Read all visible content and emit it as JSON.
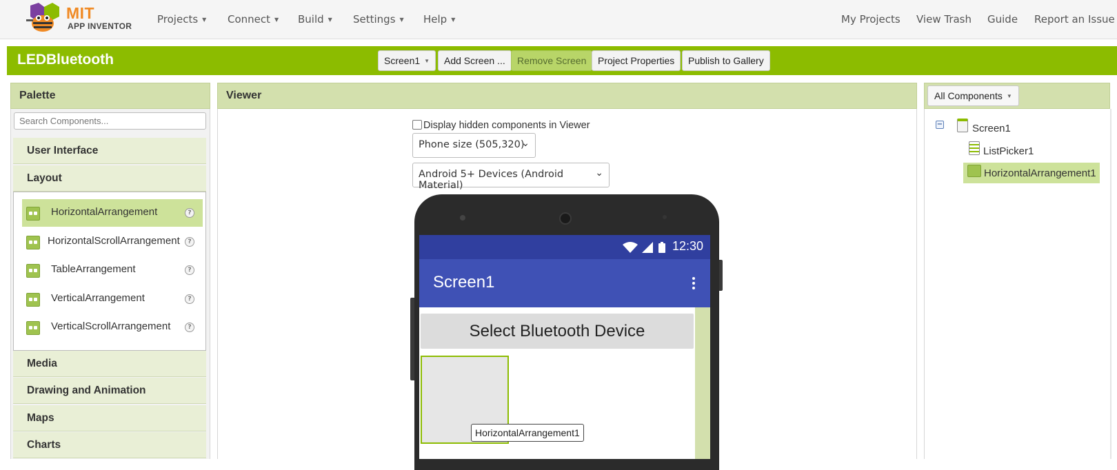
{
  "brand": {
    "line1": "MIT",
    "line2": "APP INVENTOR"
  },
  "nav": {
    "left": [
      "Projects",
      "Connect",
      "Build",
      "Settings",
      "Help"
    ],
    "right": [
      "My Projects",
      "View Trash",
      "Guide",
      "Report an Issue"
    ]
  },
  "project": {
    "name": "LEDBluetooth",
    "screen_select": "Screen1",
    "add_screen": "Add Screen ...",
    "remove_screen": "Remove Screen",
    "properties": "Project Properties",
    "publish": "Publish to Gallery"
  },
  "palette": {
    "title": "Palette",
    "search_placeholder": "Search Components...",
    "categories_top": [
      "User Interface",
      "Layout"
    ],
    "layout_items": [
      "HorizontalArrangement",
      "HorizontalScrollArrangement",
      "TableArrangement",
      "VerticalArrangement",
      "VerticalScrollArrangement"
    ],
    "categories_bottom": [
      "Media",
      "Drawing and Animation",
      "Maps",
      "Charts"
    ],
    "help_glyph": "?"
  },
  "viewer": {
    "title": "Viewer",
    "hidden_checkbox_label": "Display hidden components in Viewer",
    "phone_size": "Phone size (505,320)",
    "device_theme": "Android 5+ Devices (Android Material)",
    "time": "12:30",
    "screen_title": "Screen1",
    "listpicker_text": "Select Bluetooth Device",
    "tooltip": "HorizontalArrangement1"
  },
  "components": {
    "filter": "All Components",
    "tree": [
      "Screen1",
      "ListPicker1",
      "HorizontalArrangement1"
    ],
    "selected": "HorizontalArrangement1"
  },
  "colors": {
    "brand_green": "#8cbc00",
    "header_bg": "#d3e0ad",
    "selected_bg": "#cde29a",
    "status_bar": "#303f9f",
    "app_bar": "#3f51b5"
  }
}
